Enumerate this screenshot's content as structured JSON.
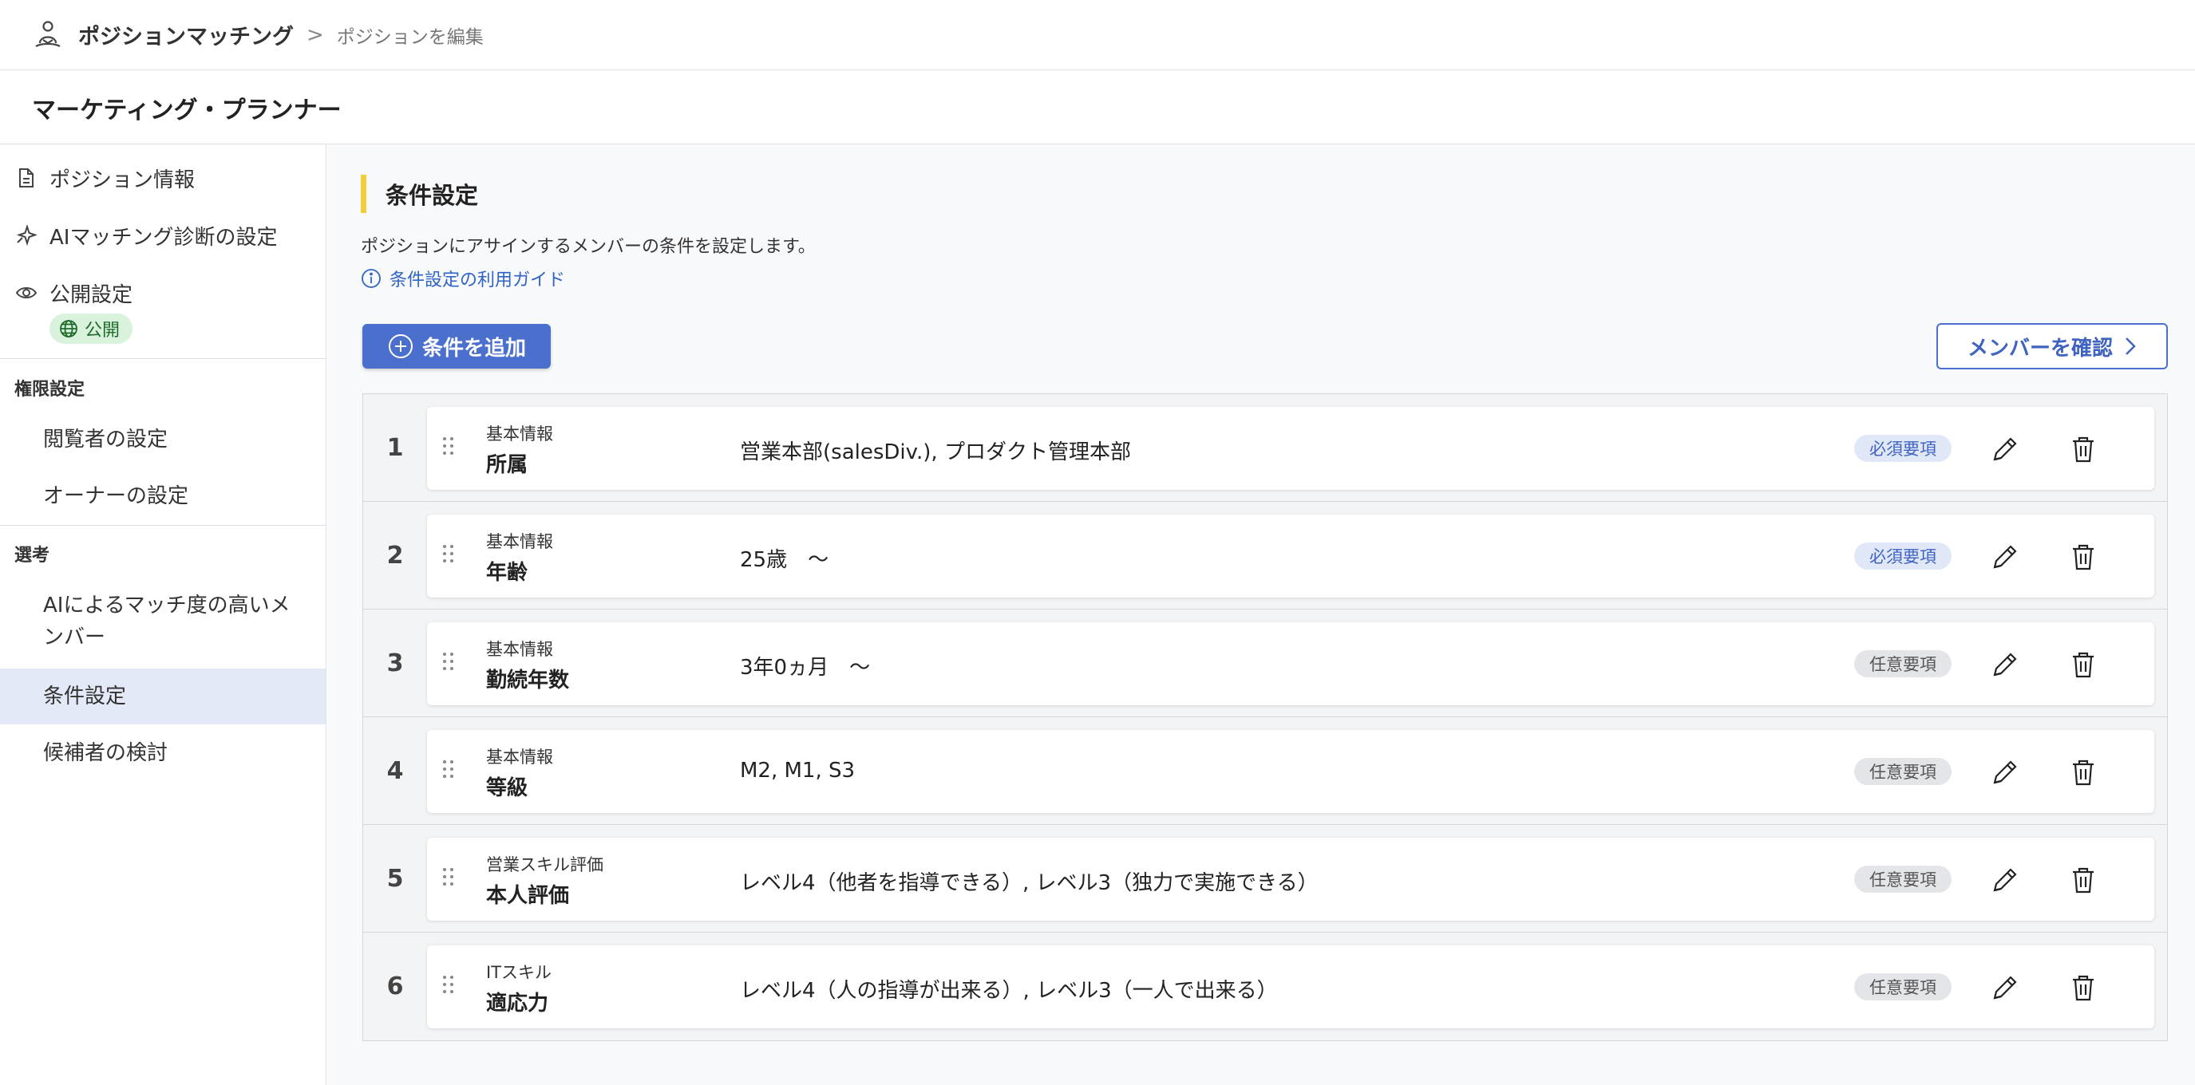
{
  "header": {
    "app_name": "ポジションマッチング",
    "breadcrumb_sep": ">",
    "breadcrumb_current": "ポジションを編集"
  },
  "page": {
    "title": "マーケティング・プランナー"
  },
  "sidebar": {
    "items": [
      {
        "label": "ポジション情報",
        "icon": "document-icon"
      },
      {
        "label": "AIマッチング診断の設定",
        "icon": "sparkle-icon"
      },
      {
        "label": "公開設定",
        "icon": "eye-icon"
      }
    ],
    "public_badge": "公開",
    "sections": [
      {
        "label": "権限設定",
        "links": [
          "閲覧者の設定",
          "オーナーの設定"
        ]
      },
      {
        "label": "選考",
        "links": [
          "AIによるマッチ度の高いメ",
          "ンバー",
          "条件設定",
          "候補者の検討"
        ]
      }
    ],
    "active": "条件設定"
  },
  "main": {
    "section_title": "条件設定",
    "description": "ポジションにアサインするメンバーの条件を設定します。",
    "guide_link": "条件設定の利用ガイド",
    "add_button": "条件を追加",
    "member_button": "メンバーを確認"
  },
  "conditions": [
    {
      "num": "1",
      "category": "基本情報",
      "name": "所属",
      "value": "営業本部(salesDiv.), プロダクト管理本部",
      "badge": "必須要項",
      "required": true
    },
    {
      "num": "2",
      "category": "基本情報",
      "name": "年齢",
      "value": "25歳　〜",
      "badge": "必須要項",
      "required": true
    },
    {
      "num": "3",
      "category": "基本情報",
      "name": "勤続年数",
      "value": "3年0ヵ月　〜",
      "badge": "任意要項",
      "required": false
    },
    {
      "num": "4",
      "category": "基本情報",
      "name": "等級",
      "value": "M2, M1, S3",
      "badge": "任意要項",
      "required": false
    },
    {
      "num": "5",
      "category": "営業スキル評価",
      "name": "本人評価",
      "value": "レベル4（他者を指導できる）, レベル3（独力で実施できる）",
      "badge": "任意要項",
      "required": false
    },
    {
      "num": "6",
      "category": "ITスキル",
      "name": "適応力",
      "value": "レベル4（人の指導が出来る）, レベル3（一人で出来る）",
      "badge": "任意要項",
      "required": false
    }
  ],
  "colors": {
    "accent": "#4a6fcc",
    "section_marker": "#f2cf3a",
    "required_badge_bg": "#e0e8f8",
    "optional_badge_bg": "#e4e5e8",
    "public_badge_bg": "#d9f2dc"
  }
}
